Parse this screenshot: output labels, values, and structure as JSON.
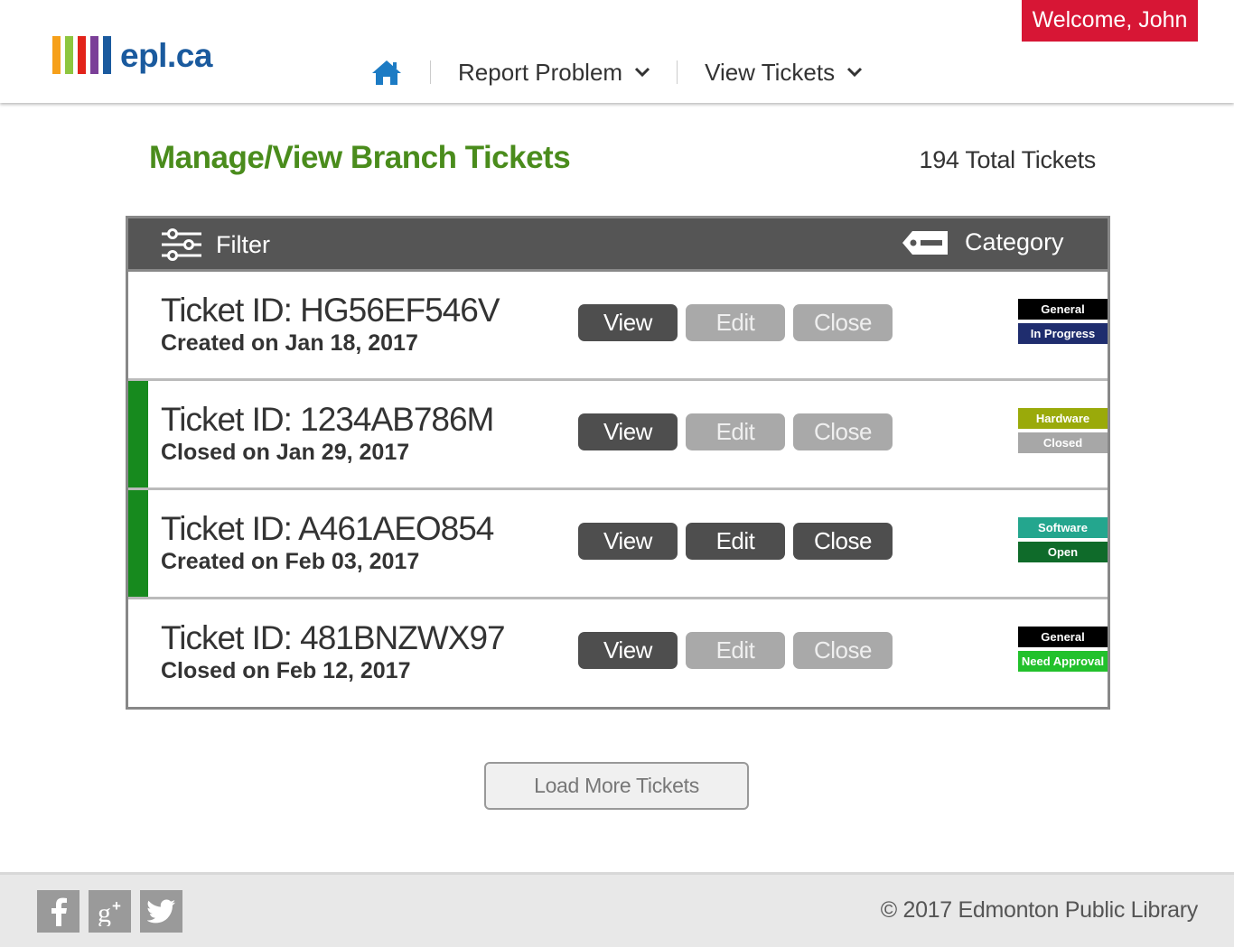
{
  "brand": {
    "logo_text": "epl.ca",
    "bar_colors": [
      "#f6a01a",
      "#8dc63f",
      "#e2231a",
      "#7b3f98",
      "#1a5a9e"
    ]
  },
  "header": {
    "welcome": "Welcome, John",
    "nav": [
      {
        "label": "Report Problem"
      },
      {
        "label": "View Tickets"
      }
    ]
  },
  "page": {
    "title": "Manage/View Branch Tickets",
    "total": "194 Total Tickets"
  },
  "table": {
    "filter_label": "Filter",
    "category_label": "Category",
    "buttons": {
      "view": "View",
      "edit": "Edit",
      "close": "Close"
    },
    "rows": [
      {
        "id": "Ticket ID: HG56EF546V",
        "date": "Created on Jan 18, 2017",
        "accent": false,
        "edit_enabled": false,
        "close_enabled": false,
        "tags": [
          {
            "label": "General",
            "color": "#000000"
          },
          {
            "label": "In Progress",
            "color": "#1f2d6e"
          }
        ]
      },
      {
        "id": "Ticket ID: 1234AB786M",
        "date": "Closed on Jan 29, 2017",
        "accent": true,
        "edit_enabled": false,
        "close_enabled": false,
        "tags": [
          {
            "label": "Hardware",
            "color": "#9aaa0a"
          },
          {
            "label": "Closed",
            "color": "#a7a7a7"
          }
        ]
      },
      {
        "id": "Ticket ID: A461AEO854",
        "date": "Created on Feb 03, 2017",
        "accent": true,
        "edit_enabled": true,
        "close_enabled": true,
        "tags": [
          {
            "label": "Software",
            "color": "#24a68e"
          },
          {
            "label": "Open",
            "color": "#0f6b2a"
          }
        ]
      },
      {
        "id": "Ticket ID: 481BNZWX97",
        "date": "Closed on Feb 12, 2017",
        "accent": false,
        "edit_enabled": false,
        "close_enabled": false,
        "tags": [
          {
            "label": "General",
            "color": "#000000"
          },
          {
            "label": "Need Approval",
            "color": "#22c12c"
          }
        ]
      }
    ]
  },
  "load_more": "Load More Tickets",
  "footer": {
    "social": [
      "facebook-icon",
      "google-plus-icon",
      "twitter-icon"
    ],
    "copyright": "© 2017 Edmonton Public Library"
  },
  "colors": {
    "accent_green": "#4a8c1c",
    "welcome_red": "#d71635",
    "home_blue": "#1c7bc4",
    "row_accent": "#178a1e"
  }
}
